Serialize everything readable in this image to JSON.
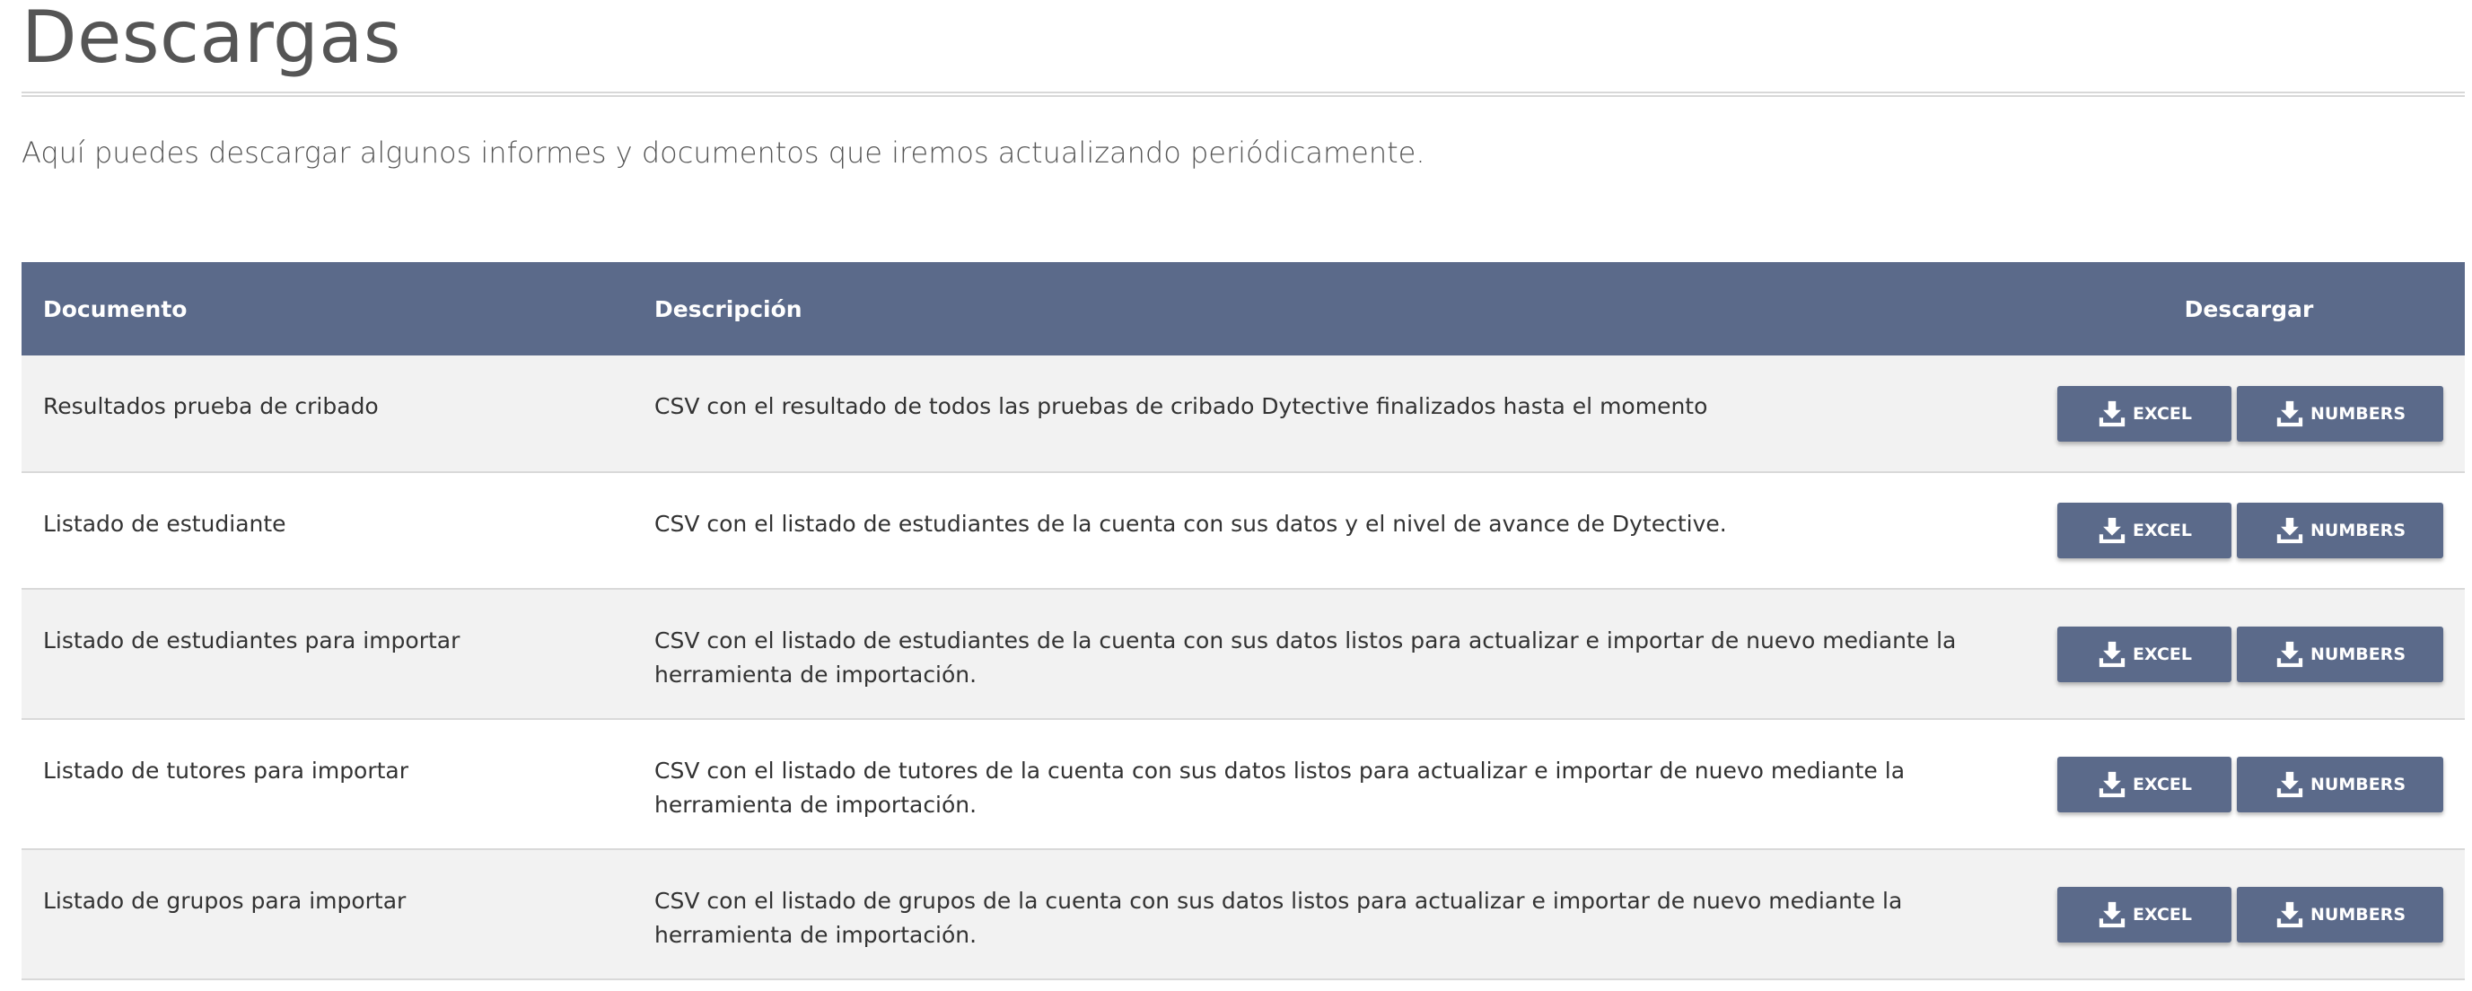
{
  "page": {
    "title": "Descargas",
    "intro": "Aquí puedes descargar algunos informes y documentos que iremos actualizando periódicamente."
  },
  "table": {
    "headers": {
      "document": "Documento",
      "description": "Descripción",
      "download": "Descargar"
    },
    "rows": [
      {
        "document": "Resultados prueba de cribado",
        "description": "CSV con el resultado de todos las pruebas de cribado Dytective finalizados hasta el momento",
        "excel_label": "EXCEL",
        "numbers_label": "NUMBERS"
      },
      {
        "document": "Listado de estudiante",
        "description": "CSV con el listado de estudiantes de la cuenta con sus datos y el nivel de avance de Dytective.",
        "excel_label": "EXCEL",
        "numbers_label": "NUMBERS"
      },
      {
        "document": "Listado de estudiantes para importar",
        "description": "CSV con el listado de estudiantes de la cuenta con sus datos listos para actualizar e importar de nuevo mediante la herramienta de importación.",
        "excel_label": "EXCEL",
        "numbers_label": "NUMBERS"
      },
      {
        "document": "Listado de tutores para importar",
        "description": "CSV con el listado de tutores de la cuenta con sus datos listos para actualizar e importar de nuevo mediante la herramienta de importación.",
        "excel_label": "EXCEL",
        "numbers_label": "NUMBERS"
      },
      {
        "document": "Listado de grupos para importar",
        "description": "CSV con el listado de grupos de la cuenta con sus datos listos para actualizar e importar de nuevo mediante la herramienta de importación.",
        "excel_label": "EXCEL",
        "numbers_label": "NUMBERS"
      }
    ]
  },
  "icons": {
    "download": "download-icon"
  },
  "colors": {
    "accent": "#5b6a8a",
    "row_alt": "#f2f2f2",
    "title_text": "#555555"
  }
}
